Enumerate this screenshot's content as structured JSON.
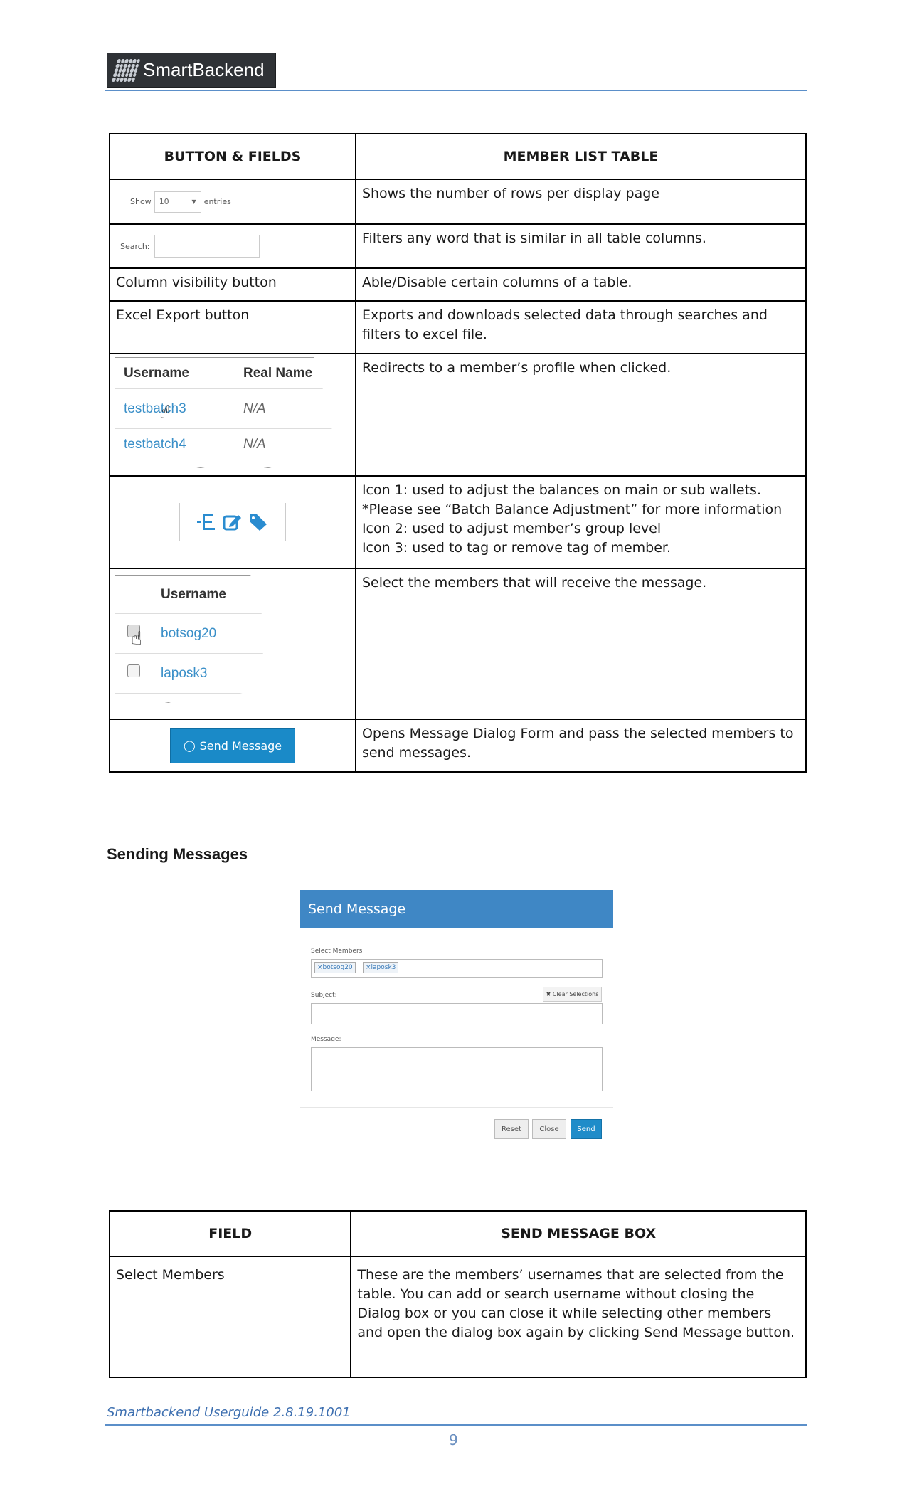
{
  "header": {
    "logo_text": "SmartBackend"
  },
  "member_table": {
    "col1_header": "BUTTON & FIELDS",
    "col2_header": "MEMBER LIST TABLE",
    "rows": [
      {
        "widget": "show-entries",
        "description": "Shows the number of rows per display page"
      },
      {
        "widget": "search",
        "description": "Filters any word that is similar in all table columns."
      },
      {
        "label": "Column visibility button",
        "description": "Able/Disable certain columns of a table."
      },
      {
        "label": "Excel Export button",
        "description": "Exports and downloads selected data through searches and filters to excel file."
      },
      {
        "widget": "username-link",
        "description": "Redirects to a member’s profile when clicked."
      },
      {
        "widget": "action-icons",
        "description_lines": [
          "Icon 1: used to adjust the balances on main or sub wallets.",
          "*Please see “Batch Balance Adjustment” for more information",
          "Icon 2: used to adjust member’s group level",
          "Icon 3: used to tag or remove tag of member."
        ]
      },
      {
        "widget": "checkbox-select",
        "description": "Select the members that will receive the message."
      },
      {
        "widget": "send-button",
        "description": "Opens Message Dialog Form and pass the selected members to send messages."
      }
    ],
    "widgets": {
      "show_label": "Show",
      "show_value": "10",
      "entries_label": "entries",
      "search_label": "Search:",
      "username_header": "Username",
      "realname_header": "Real Name",
      "user1": "testbatch3",
      "user1_real": "N/A",
      "user2": "testbatch4",
      "user2_real": "N/A",
      "checkbox_user1": "botsog20",
      "checkbox_user2": "laposk3",
      "send_button_label": "Send Message"
    }
  },
  "section_title": "Sending Messages",
  "dialog": {
    "title": "Send Message",
    "select_members_label": "Select Members",
    "tags": [
      "×botsog20",
      "×laposk3"
    ],
    "clear_button": "✖ Clear Selections",
    "subject_label": "Subject:",
    "message_label": "Message:",
    "reset_button": "Reset",
    "close_button": "Close",
    "send_button": "Send"
  },
  "field_table": {
    "col1_header": "FIELD",
    "col2_header": "SEND MESSAGE BOX",
    "rows": [
      {
        "label": "Select Members",
        "description": "These are the members’ usernames that are selected from the table. You can add or search username without closing the Dialog box or you can close it while selecting other members and open the dialog box again by clicking Send Message button."
      }
    ]
  },
  "footer": {
    "guide_text": "Smartbackend Userguide 2.8.19.1001",
    "page_number": "9"
  },
  "colors": {
    "accent": "#3f87c5",
    "button": "#1a8ac8",
    "rule": "#5b8fc9",
    "link": "#3a8fc8"
  }
}
